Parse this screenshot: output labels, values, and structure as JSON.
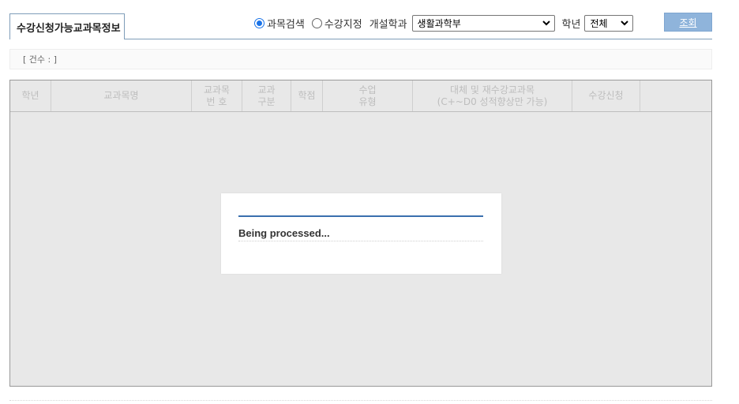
{
  "tab": {
    "title": "수강신청가능교과목정보"
  },
  "search": {
    "radios": [
      {
        "label": "과목검색",
        "checked": true
      },
      {
        "label": "수강지정",
        "checked": false
      }
    ],
    "department_label": "개설학과",
    "department_value": "생활과학부",
    "grade_label": "학년",
    "grade_value": "전체",
    "query_button": "조회"
  },
  "count": {
    "text": "[ 건수 : ]"
  },
  "table": {
    "headers": [
      {
        "line1": "학년",
        "line2": ""
      },
      {
        "line1": "교과목명",
        "line2": ""
      },
      {
        "line1": "교과목",
        "line2": "번 호"
      },
      {
        "line1": "교과",
        "line2": "구분"
      },
      {
        "line1": "학점",
        "line2": ""
      },
      {
        "line1": "수업",
        "line2": "유형"
      },
      {
        "line1": "대체 및 재수강교과목",
        "line2": "(C+~D0 성적향상만 가능)"
      },
      {
        "line1": "수강신청",
        "line2": ""
      },
      {
        "line1": "",
        "line2": ""
      }
    ]
  },
  "dialog": {
    "message": "Being processed..."
  },
  "colors": {
    "accent": "#1a73e8",
    "button": "#8fb4db",
    "tab_border": "#7f9db9",
    "dialog_line": "#3a6fae",
    "table_bg": "#e8e8e8"
  }
}
